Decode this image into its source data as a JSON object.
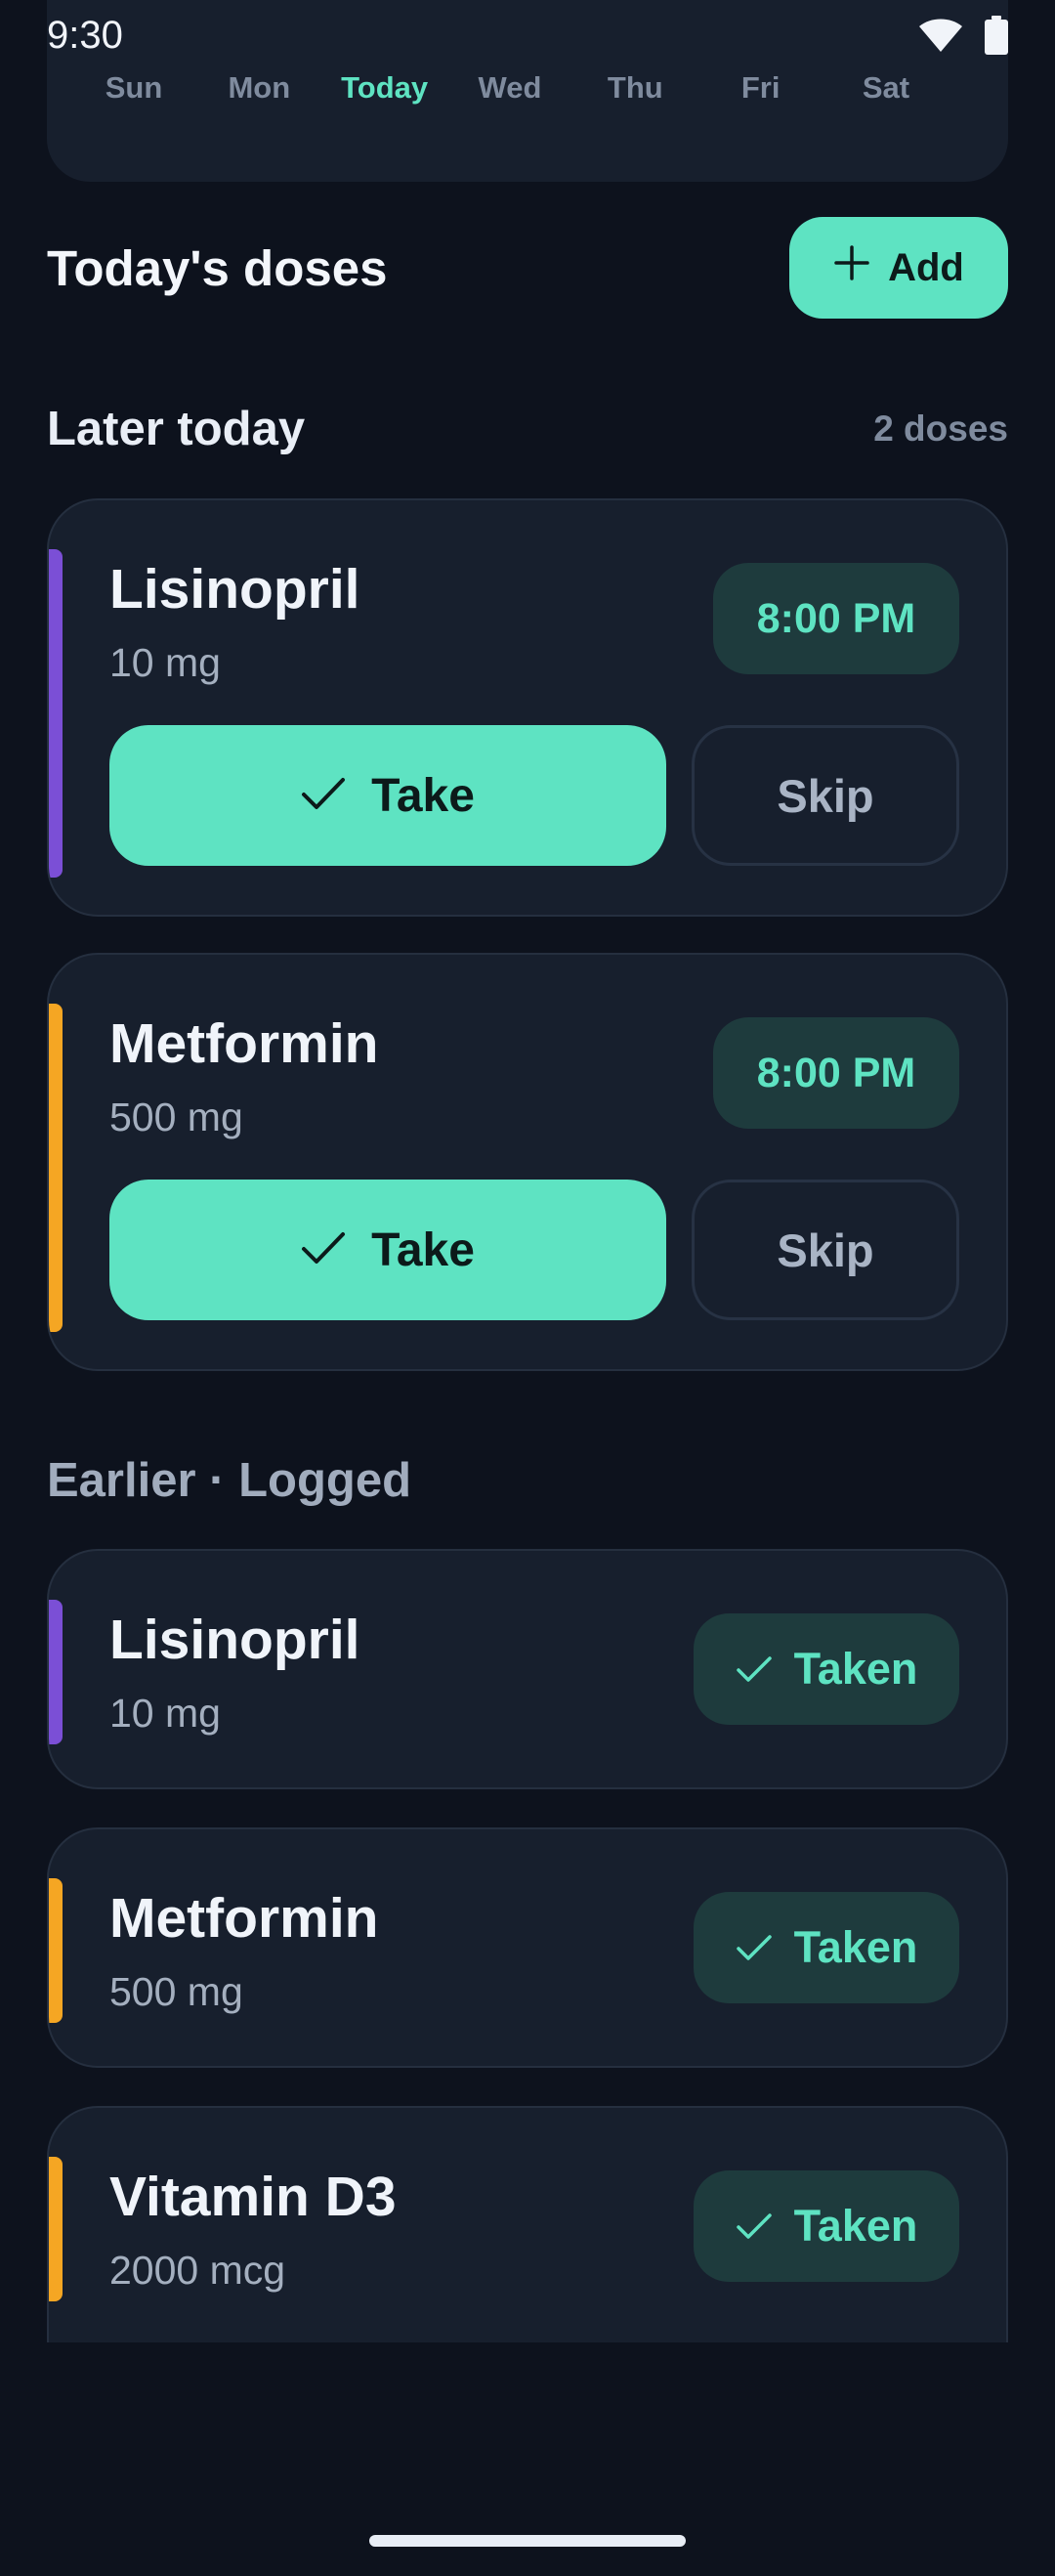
{
  "status": {
    "time": "9:30"
  },
  "week": {
    "days": [
      "Sun",
      "Mon",
      "Today",
      "Wed",
      "Thu",
      "Fri",
      "Sat"
    ],
    "active": "Today"
  },
  "header": {
    "title": "Today's doses",
    "add_label": "Add"
  },
  "later": {
    "title": "Later today",
    "count": "2 doses",
    "items": [
      {
        "name": "Lisinopril",
        "dose": "10 mg",
        "time": "8:00 PM",
        "take_label": "Take",
        "skip_label": "Skip",
        "color": "#7b4fd6"
      },
      {
        "name": "Metformin",
        "dose": "500 mg",
        "time": "8:00 PM",
        "take_label": "Take",
        "skip_label": "Skip",
        "color": "#f5a623"
      }
    ]
  },
  "earlier": {
    "title": "Earlier · Logged",
    "items": [
      {
        "name": "Lisinopril",
        "dose": "10 mg",
        "status": "Taken",
        "color": "#7b4fd6"
      },
      {
        "name": "Metformin",
        "dose": "500 mg",
        "status": "Taken",
        "color": "#f5a623"
      },
      {
        "name": "Vitamin D3",
        "dose": "2000 mcg",
        "status": "Taken",
        "color": "#f5a623"
      }
    ]
  },
  "colors": {
    "accent": "#5ee3c2",
    "background": "#0d121d",
    "card": "#171f2d"
  }
}
